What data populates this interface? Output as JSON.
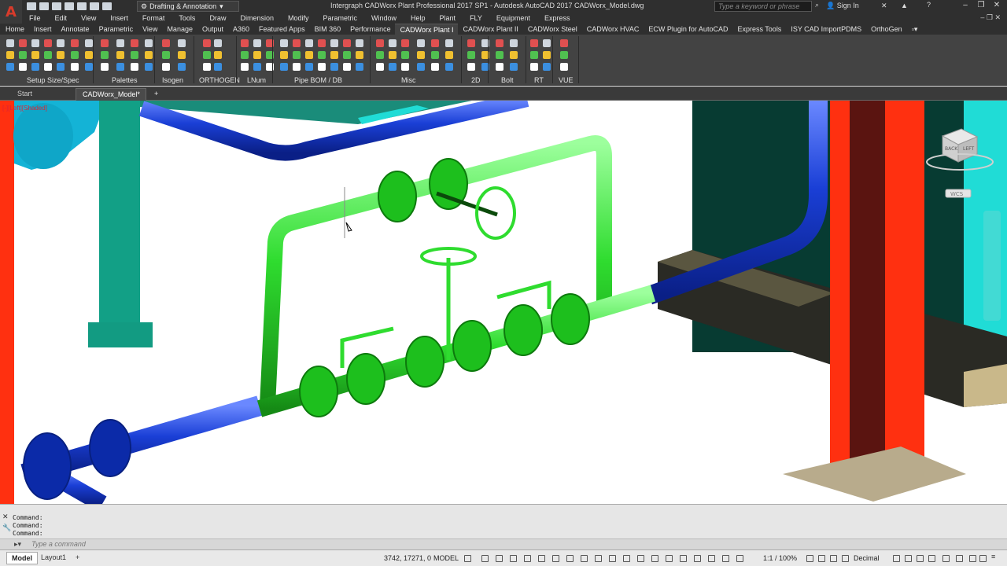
{
  "title_bar": {
    "workspace": "Drafting & Annotation",
    "app_title": "Intergraph CADWorx Plant Professional 2017 SP1 - Autodesk AutoCAD 2017   CADWorx_Model.dwg",
    "search_placeholder": "Type a keyword or phrase",
    "sign_in": "Sign In",
    "logo": "A"
  },
  "menu": [
    "File",
    "Edit",
    "View",
    "Insert",
    "Format",
    "Tools",
    "Draw",
    "Dimension",
    "Modify",
    "Parametric",
    "Window",
    "Help",
    "Plant",
    "FLY",
    "Equipment",
    "Express"
  ],
  "ribbon_tabs": [
    "Home",
    "Insert",
    "Annotate",
    "Parametric",
    "View",
    "Manage",
    "Output",
    "A360",
    "Featured Apps",
    "BIM 360",
    "Performance",
    "CADWorx Plant I",
    "CADWorx Plant II",
    "CADWorx Steel",
    "CADWorx HVAC",
    "ECW Plugin for AutoCAD",
    "Express Tools",
    "ISY CAD ImportPDMS",
    "OrthoGen"
  ],
  "active_ribbon_tab": "CADWorx Plant I",
  "ribbon_panels": [
    "Setup Size/Spec",
    "Palettes",
    "Isogen",
    "ORTHOGEN",
    "LNum",
    "Pipe BOM / DB",
    "Misc",
    "2D",
    "Bolt",
    "RT",
    "VUE"
  ],
  "doc_tabs": {
    "start": "Start",
    "model": "CADWorx_Model*"
  },
  "viewport": {
    "label": "[-][Left][Shaded]",
    "viewcube_top": "BACK",
    "viewcube_side": "LEFT",
    "wcs": "WCS"
  },
  "command": {
    "lines": [
      "Command:",
      "Command:",
      "Command:"
    ],
    "placeholder": "Type a command"
  },
  "status": {
    "layout_tabs": [
      "Model",
      "Layout1"
    ],
    "coords": "3742, 17271, 0",
    "mode": "MODEL",
    "scale": "1:1 / 100%",
    "units": "Decimal"
  },
  "colors": {
    "pipe_blue": "#1a3fd6",
    "pipe_green": "#2fdc2f",
    "steel_red": "#ff3010",
    "equipment_teal": "#12a086"
  }
}
